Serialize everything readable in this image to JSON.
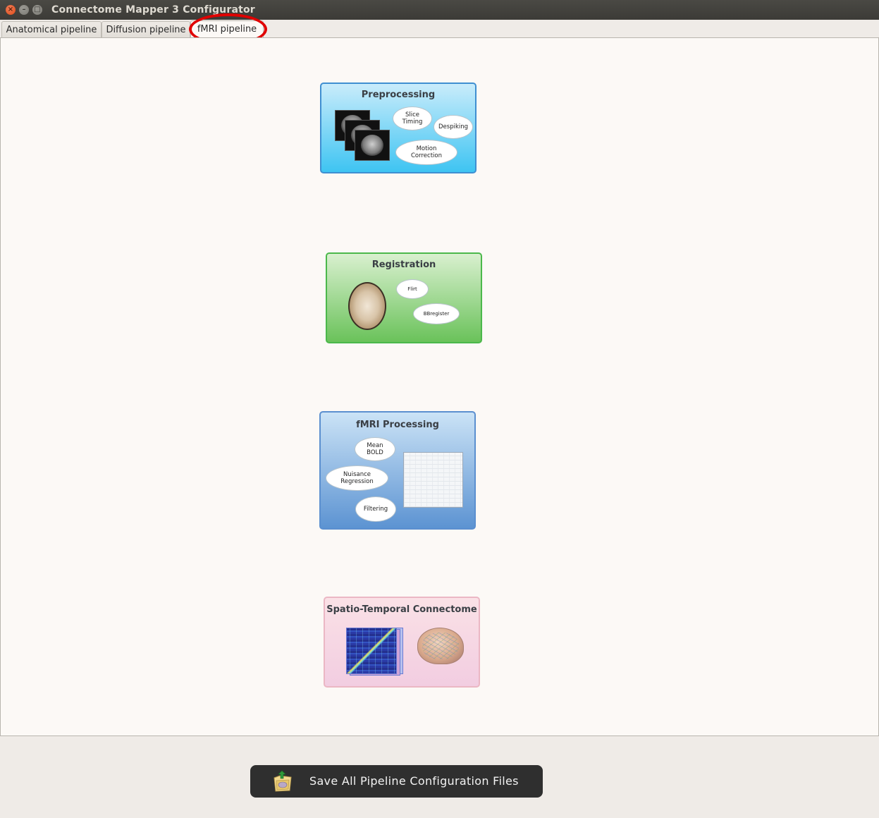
{
  "window": {
    "title": "Connectome Mapper 3 Configurator",
    "controls": [
      "close-icon",
      "minimize-icon",
      "maximize-icon"
    ]
  },
  "tabs": [
    {
      "label": "Anatomical pipeline",
      "active": false
    },
    {
      "label": "Diffusion pipeline",
      "active": false
    },
    {
      "label": "fMRI pipeline",
      "active": true
    }
  ],
  "highlight_color": "#e00000",
  "stages": {
    "preprocessing": {
      "title": "Preprocessing",
      "steps": [
        "Slice\nTiming",
        "Despiking",
        "Motion\nCorrection"
      ]
    },
    "registration": {
      "title": "Registration",
      "steps": [
        "Flirt",
        "BBregister"
      ]
    },
    "fmri_processing": {
      "title": "fMRI Processing",
      "steps": [
        "Mean\nBOLD",
        "Nuisance\nRegression",
        "Filtering"
      ]
    },
    "connectome": {
      "title": "Spatio-Temporal Connectome"
    }
  },
  "save_button": {
    "label": "Save All Pipeline Configuration Files",
    "icon": "save-config-icon"
  },
  "colors": {
    "preprocessing": "#3ec4f2",
    "registration": "#6ac25a",
    "fmri_processing": "#5c93d2",
    "connectome": "#f2cde1"
  }
}
